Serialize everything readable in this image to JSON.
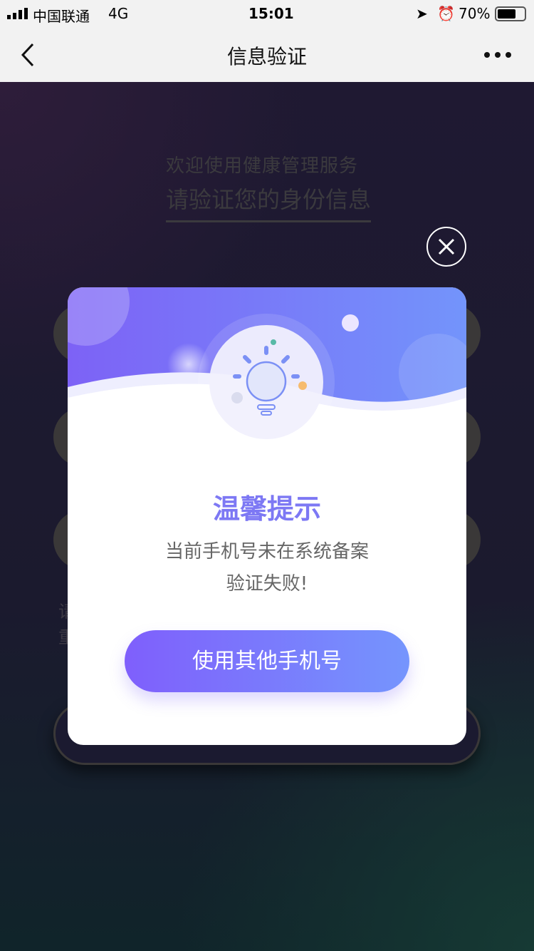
{
  "status_bar": {
    "carrier": "中国联通",
    "network": "4G",
    "time": "15:01",
    "battery": "70%"
  },
  "nav": {
    "title": "信息验证",
    "more_icon": "ellipsis-icon",
    "back_icon": "chevron-left-icon"
  },
  "background": {
    "welcome": "欢迎使用健康管理服务",
    "subtitle": "请验证您的身份信息",
    "hint_fragment_1": "请",
    "hint_fragment_2": "重"
  },
  "modal": {
    "title": "温馨提示",
    "message_line1": "当前手机号未在系统备案",
    "message_line2": "验证失败!",
    "button": "使用其他手机号",
    "close_icon": "close-circle-icon",
    "illustration_icon": "lightbulb-icon"
  },
  "colors": {
    "accent_start": "#7f5ffc",
    "accent_end": "#7595fd",
    "title": "#7d78f4"
  }
}
